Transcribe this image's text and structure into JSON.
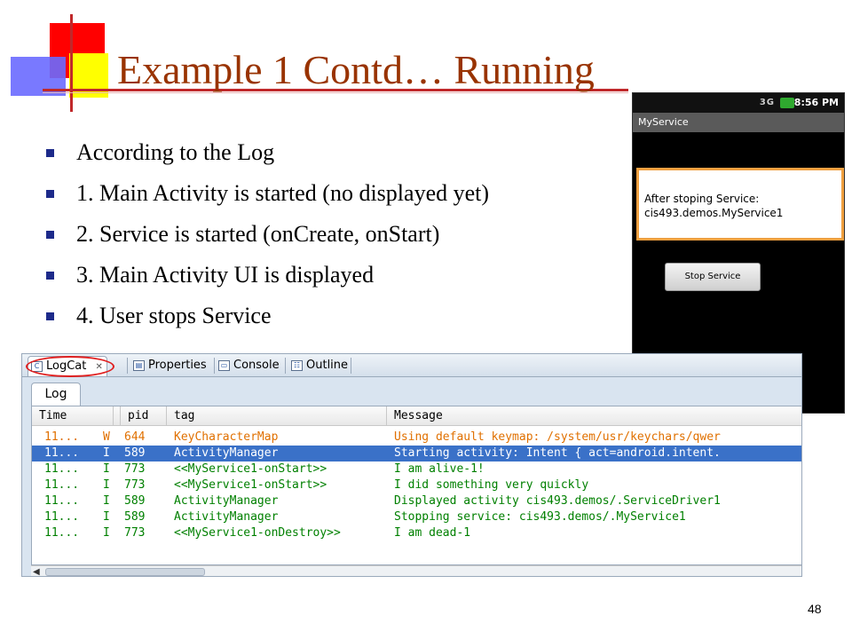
{
  "slide": {
    "title": "Example 1 Contd… Running",
    "page_number": "48",
    "bullets": [
      "According to the Log",
      "1. Main Activity is started (no displayed yet)",
      "2. Service is started (onCreate, onStart)",
      "3. Main Activity UI is displayed",
      "4. User stops Service"
    ]
  },
  "phone": {
    "time": "8:56 PM",
    "status_icons": "3G",
    "app_title": "MyService",
    "message_line1": "After stoping Service:",
    "message_line2": "cis493.demos.MyService1",
    "button_label": "Stop Service"
  },
  "logcat": {
    "tabs": [
      "LogCat",
      "Properties",
      "Console",
      "Outline"
    ],
    "inner_tab": "Log",
    "columns": [
      "Time",
      "pid",
      "tag",
      "Message"
    ],
    "rows": [
      {
        "time": "11...",
        "level": "W",
        "pid": "644",
        "tag": "KeyCharacterMap",
        "message": "Using default keymap: /system/usr/keychars/qwer"
      },
      {
        "time": "11...",
        "level": "I",
        "pid": "589",
        "tag": "ActivityManager",
        "message": "Starting activity: Intent { act=android.intent."
      },
      {
        "time": "11...",
        "level": "I",
        "pid": "773",
        "tag": "<<MyService1-onStart>>",
        "message": "I am alive-1!"
      },
      {
        "time": "11...",
        "level": "I",
        "pid": "773",
        "tag": "<<MyService1-onStart>>",
        "message": "I did something very quickly"
      },
      {
        "time": "11...",
        "level": "I",
        "pid": "589",
        "tag": "ActivityManager",
        "message": "Displayed activity cis493.demos/.ServiceDriver1"
      },
      {
        "time": "11...",
        "level": "I",
        "pid": "589",
        "tag": "ActivityManager",
        "message": "Stopping service: cis493.demos/.MyService1"
      },
      {
        "time": "11...",
        "level": "I",
        "pid": "773",
        "tag": "<<MyService1-onDestroy>>",
        "message": "I am dead-1"
      }
    ],
    "selected_row": 1
  },
  "colors": {
    "title": "#993300",
    "bullet": "#1d2a8a",
    "selection": "#3a71c8",
    "warn_text": "#e07000",
    "info_text": "#008000"
  }
}
